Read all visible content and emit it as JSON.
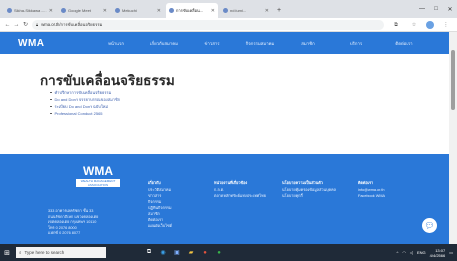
{
  "browser": {
    "tabs": [
      {
        "label": "Sikha-Sikkawa - Gl...",
        "active": false
      },
      {
        "label": "Google Meet",
        "active": false
      },
      {
        "label": "Mekuchi",
        "active": false
      },
      {
        "label": "การขับเคลื่อน...",
        "active": true
      },
      {
        "label": "nd:lumi...",
        "active": false
      }
    ],
    "new_tab": "+",
    "url": "wma.or.th/การขับเคลื่อนจริยธรรม"
  },
  "site": {
    "logo": "WMA",
    "nav": [
      "หน้าแรก",
      "เกี่ยวกับสมาคม",
      "ข่าวสาร",
      "กิจกรรมสมาคม",
      "สมาชิก",
      "บริการ",
      "ติดต่อเรา"
    ]
  },
  "page": {
    "title": "การขับเคลื่อนจริยธรรม",
    "links": [
      "คำปรึกษาการขับเคลื่อนจริยธรรม",
      "Do and Don't จรรยาบรรณของสมาชิก",
      "ระเบียบ Do and Don't ฉบับใหม่",
      "Professional Conduct 2565"
    ]
  },
  "footer": {
    "logo": "WMA",
    "logo_sub": "WEALTH MANAGEMENT ASSOCIATION",
    "address": [
      "333 อาคารเลครัชดา ชั้น 33",
      "ถนนรัชดาภิเษก แขวงคลองเตย",
      "เขตคลองเตย กรุงเทพฯ 10110",
      "โทร 0 2076 8000",
      "แฟกซ์ 0 2076 8077"
    ],
    "columns": [
      {
        "heading": "เกี่ยวกับ",
        "items": [
          "ประวัติสมาคม",
          "ข่าวสาร",
          "กิจกรรม",
          "ปฏิทินกิจกรรม",
          "สมาชิก",
          "ติดต่อเรา",
          "แผนผังเว็บไซต์"
        ]
      },
      {
        "heading": "หน่วยงานที่เกี่ยวข้อง",
        "items": [
          "ก.ล.ต.",
          "ตลาดหลักทรัพย์แห่งประเทศไทย"
        ]
      },
      {
        "heading": "นโยบายความเป็นส่วนตัว",
        "items": [
          "นโยบายคุ้มครองข้อมูลส่วนบุคคล",
          "นโยบายคุกกี้"
        ]
      },
      {
        "heading": "ติดต่อเรา",
        "items": [
          "info@wma.or.th",
          "Facebook WMA"
        ]
      }
    ]
  },
  "taskbar": {
    "search_placeholder": "Type here to search",
    "time": "13:07",
    "date": "4/4/2566",
    "lang": "ENG"
  }
}
